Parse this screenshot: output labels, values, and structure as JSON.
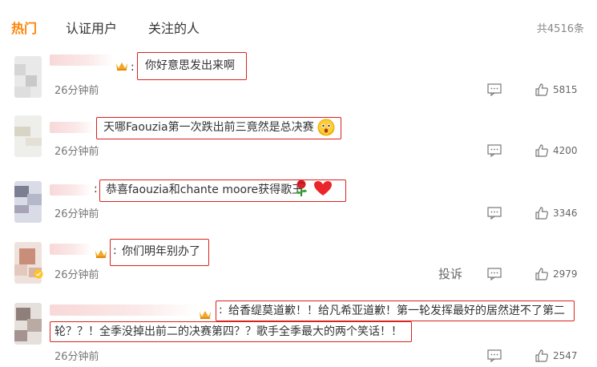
{
  "tabs": [
    {
      "label": "热门",
      "active": true
    },
    {
      "label": "认证用户",
      "active": false
    },
    {
      "label": "关注的人",
      "active": false
    }
  ],
  "total": "共4516条",
  "comments": [
    {
      "text": "你好意思发出来啊",
      "time": "26分钟前",
      "likes": "5815",
      "has_crown": true
    },
    {
      "text": "天哪Faouzia第一次跌出前三竟然是总决赛",
      "time": "26分钟前",
      "likes": "4200",
      "has_crown": false,
      "emoji": "surprised-face-emoji"
    },
    {
      "text": "恭喜faouzia和chante moore获得歌王",
      "time": "26分钟前",
      "likes": "3346",
      "has_crown": false,
      "emoji": [
        "rose-emoji",
        "red-heart-emoji"
      ]
    },
    {
      "text": "你们明年别办了",
      "time": "26分钟前",
      "likes": "2979",
      "has_crown": true,
      "report_label": "投诉"
    },
    {
      "text_line1": "给香缇莫道歉！！给凡希亚道歉！第一轮发挥最好的居然进不了第二",
      "text_line2": "轮？？！全季没掉出前二的决赛第四？？歌手全季最大的两个笑话！！",
      "time": "26分钟前",
      "likes": "2547",
      "has_crown": true
    }
  ],
  "colors": {
    "accent": "#ff8200",
    "highlight_box": "#d9231e",
    "crown": "#f5a623"
  },
  "icons": [
    "reply-icon",
    "like-icon",
    "crown-icon"
  ]
}
